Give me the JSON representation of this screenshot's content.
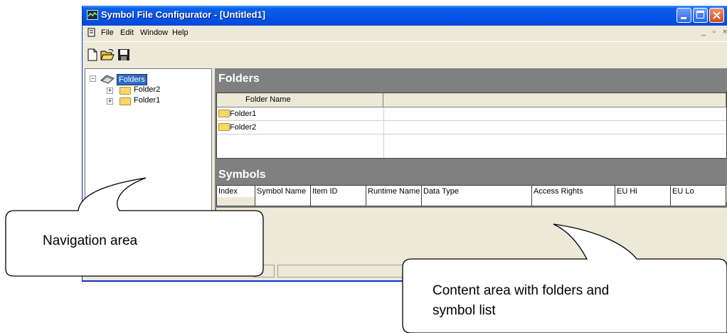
{
  "window": {
    "title": "Symbol File Configurator - [Untitled1]"
  },
  "menu": {
    "items": [
      "File",
      "Edit",
      "Window",
      "Help"
    ],
    "mdi_controls": [
      "_",
      "\u0005",
      "×"
    ]
  },
  "toolbar": {
    "buttons": [
      "new-file-icon",
      "open-folder-icon",
      "save-icon"
    ]
  },
  "navigation": {
    "root": {
      "label": "Folders",
      "expanded": true
    },
    "children": [
      {
        "label": "Folder2",
        "expanded": false
      },
      {
        "label": "Folder1",
        "expanded": false
      }
    ]
  },
  "folders_section": {
    "title": "Folders",
    "column_header": "Folder Name",
    "rows": [
      "Folder1",
      "Folder2"
    ]
  },
  "symbols_section": {
    "title": "Symbols",
    "columns": [
      "Index",
      "Symbol Name",
      "Item ID",
      "Runtime Name",
      "Data Type",
      "Access Rights",
      "EU Hi",
      "EU Lo"
    ]
  },
  "callouts": {
    "navigation": "Navigation area",
    "content_line1": "Content area with folders and",
    "content_line2": "symbol list"
  },
  "colors": {
    "titlebar": "#0553e6",
    "window_bg": "#ece9d8",
    "section_header": "#808080",
    "folder_icon": "#f8d86a"
  }
}
